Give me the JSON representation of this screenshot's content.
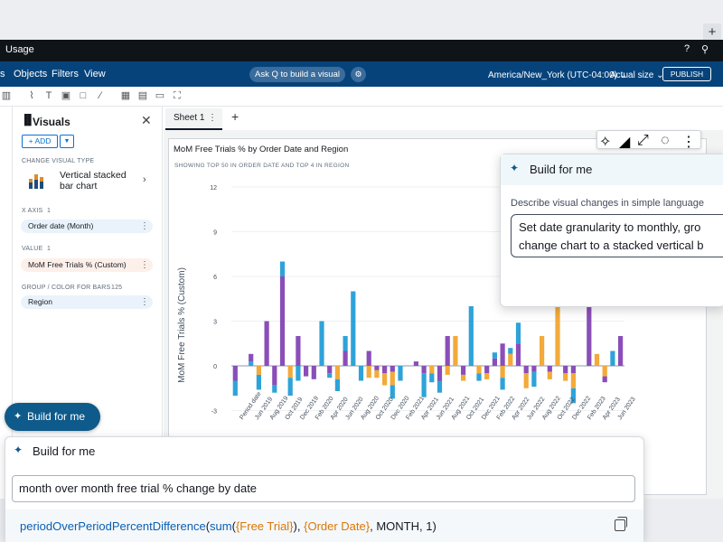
{
  "window": {
    "plus": "+",
    "title": "Usage"
  },
  "menubar": {
    "items": [
      "s",
      "Objects",
      "Filters",
      "View"
    ],
    "ask_q": "Ask Q to build a visual",
    "timezone": "America/New_York (UTC-04:00) ⌄",
    "fit": "Actual size ⌄",
    "publish": "PUBLISH"
  },
  "sheet": {
    "tab": "Sheet 1",
    "plus": "+"
  },
  "visuals_panel": {
    "title": "Visuals",
    "close": "✕",
    "add": "+ ADD",
    "add_drop": "▼",
    "change_type_label": "CHANGE VISUAL TYPE",
    "visual_type": "Vertical stacked bar chart",
    "x_axis_label": "X AXIS",
    "x_axis_count": "1",
    "x_axis_field": "Order date (Month)",
    "value_label": "VALUE",
    "value_count": "1",
    "value_field": "MoM Free Trials % (Custom)",
    "group_label": "GROUP / COLOR FOR BARS",
    "group_count": "125",
    "group_field": "Region"
  },
  "build_for_me_button": "Build for me",
  "visual": {
    "title": "MoM Free Trials % by Order Date and Region",
    "subtitle": "SHOWING TOP 50 IN ORDER DATE AND TOP 4 IN REGION"
  },
  "build_for_me_popover": {
    "title": "Build for me",
    "label": "Describe visual changes in simple language",
    "text_line1": "Set date granularity to monthly, gro",
    "text_line2": "change chart to a stacked vertical b"
  },
  "build_for_me_panel": {
    "title": "Build for me",
    "query": "month over month free trial % change by date",
    "formula_fn": "periodOverPeriodPercentDifference",
    "formula_sum": "sum",
    "formula_field1": "{Free Trial}",
    "formula_field2": "{Order Date}",
    "formula_rest": ", MONTH, 1)"
  },
  "colors": {
    "purple": "#8a4eb8",
    "blue": "#2ea3d9",
    "orange": "#f2aa3a",
    "nav": "#06437b",
    "accent": "#0e5a8a"
  },
  "chart_data": {
    "type": "bar",
    "stacked": true,
    "ylabel": "MoM Free Trials % (Custom)",
    "ylim": [
      -4.5,
      12
    ],
    "yticks": [
      12,
      9,
      6,
      3,
      0,
      -3
    ],
    "xtick_labels": [
      "Period date",
      "Jun 2019",
      "Aug 2019",
      "Oct 2019",
      "Dec 2019",
      "Feb 2020",
      "Apr 2020",
      "Jun 2020",
      "Aug 2020",
      "Oct 2020",
      "Dec 2020",
      "Feb 2021",
      "Apr 2021",
      "Jun 2021",
      "Aug 2021",
      "Oct 2021",
      "Dec 2021",
      "Feb 2022",
      "Apr 2022",
      "Jun 2022",
      "Aug 2022",
      "Oct 2022",
      "Dec 2022",
      "Feb 2023",
      "Apr 2023",
      "Jun 2023"
    ],
    "bars": [
      {
        "segs": [
          [
            "purple",
            -1
          ],
          [
            "blue",
            -1
          ]
        ]
      },
      {
        "segs": []
      },
      {
        "segs": [
          [
            "blue",
            0.3
          ],
          [
            "purple",
            0.5
          ]
        ]
      },
      {
        "segs": [
          [
            "orange",
            -0.6
          ],
          [
            "blue",
            -1
          ]
        ]
      },
      {
        "segs": [
          [
            "purple",
            3
          ]
        ]
      },
      {
        "segs": [
          [
            "purple",
            -1.3
          ],
          [
            "blue",
            -0.5
          ]
        ]
      },
      {
        "segs": [
          [
            "purple",
            6
          ],
          [
            "blue",
            1
          ]
        ]
      },
      {
        "segs": [
          [
            "orange",
            -0.8
          ],
          [
            "blue",
            -1.2
          ]
        ]
      },
      {
        "segs": [
          [
            "purple",
            2
          ],
          [
            "blue",
            -1
          ]
        ]
      },
      {
        "segs": [
          [
            "purple",
            -0.7
          ]
        ]
      },
      {
        "segs": [
          [
            "purple",
            -0.9
          ]
        ]
      },
      {
        "segs": [
          [
            "blue",
            3
          ]
        ]
      },
      {
        "segs": [
          [
            "purple",
            -0.5
          ],
          [
            "blue",
            -0.3
          ]
        ]
      },
      {
        "segs": [
          [
            "orange",
            -0.9
          ],
          [
            "blue",
            -0.8
          ]
        ]
      },
      {
        "segs": [
          [
            "purple",
            1
          ],
          [
            "blue",
            1
          ]
        ]
      },
      {
        "segs": [
          [
            "blue",
            5
          ]
        ]
      },
      {
        "segs": [
          [
            "blue",
            -1
          ]
        ]
      },
      {
        "segs": [
          [
            "purple",
            1
          ],
          [
            "orange",
            -0.8
          ]
        ]
      },
      {
        "segs": [
          [
            "purple",
            -0.3
          ],
          [
            "orange",
            -0.5
          ]
        ]
      },
      {
        "segs": [
          [
            "purple",
            -0.5
          ],
          [
            "orange",
            -0.8
          ]
        ]
      },
      {
        "segs": [
          [
            "purple",
            -0.4
          ],
          [
            "orange",
            -0.9
          ],
          [
            "blue",
            -0.9
          ]
        ]
      },
      {
        "segs": [
          [
            "blue",
            -1
          ]
        ]
      },
      {
        "segs": []
      },
      {
        "segs": [
          [
            "purple",
            0.3
          ]
        ]
      },
      {
        "segs": [
          [
            "purple",
            -0.5
          ],
          [
            "blue",
            -1.6
          ]
        ]
      },
      {
        "segs": [
          [
            "orange",
            -0.5
          ],
          [
            "blue",
            -0.6
          ]
        ]
      },
      {
        "segs": [
          [
            "purple",
            -1
          ],
          [
            "blue",
            -0.8
          ]
        ]
      },
      {
        "segs": [
          [
            "purple",
            2
          ],
          [
            "orange",
            -0.6
          ]
        ]
      },
      {
        "segs": [
          [
            "orange",
            2
          ]
        ]
      },
      {
        "segs": [
          [
            "purple",
            -0.6
          ],
          [
            "orange",
            -0.4
          ]
        ]
      },
      {
        "segs": [
          [
            "blue",
            4
          ]
        ]
      },
      {
        "segs": [
          [
            "orange",
            -0.5
          ],
          [
            "blue",
            -0.5
          ]
        ]
      },
      {
        "segs": [
          [
            "purple",
            -0.5
          ],
          [
            "orange",
            -0.4
          ]
        ]
      },
      {
        "segs": [
          [
            "purple",
            0.5
          ],
          [
            "blue",
            0.4
          ]
        ]
      },
      {
        "segs": [
          [
            "purple",
            1.5
          ],
          [
            "orange",
            -0.8
          ],
          [
            "blue",
            -0.8
          ]
        ]
      },
      {
        "segs": [
          [
            "orange",
            0.8
          ],
          [
            "blue",
            0.4
          ]
        ]
      },
      {
        "segs": [
          [
            "purple",
            1.5
          ],
          [
            "blue",
            1.4
          ]
        ]
      },
      {
        "segs": [
          [
            "purple",
            -0.5
          ],
          [
            "orange",
            -1
          ]
        ]
      },
      {
        "segs": [
          [
            "purple",
            -0.4
          ],
          [
            "blue",
            -1
          ]
        ]
      },
      {
        "segs": [
          [
            "orange",
            2
          ]
        ]
      },
      {
        "segs": [
          [
            "purple",
            -0.4
          ],
          [
            "orange",
            -0.5
          ]
        ]
      },
      {
        "segs": [
          [
            "orange",
            4
          ]
        ]
      },
      {
        "segs": [
          [
            "purple",
            -0.5
          ],
          [
            "orange",
            -0.5
          ]
        ]
      },
      {
        "segs": [
          [
            "purple",
            -0.5
          ],
          [
            "orange",
            -1
          ],
          [
            "blue",
            -1
          ]
        ]
      },
      {
        "segs": []
      },
      {
        "segs": [
          [
            "purple",
            4
          ]
        ]
      },
      {
        "segs": [
          [
            "orange",
            0.8
          ]
        ]
      },
      {
        "segs": [
          [
            "orange",
            -0.7
          ],
          [
            "purple",
            -0.4
          ]
        ]
      },
      {
        "segs": [
          [
            "blue",
            1
          ]
        ]
      },
      {
        "segs": [
          [
            "purple",
            2
          ]
        ]
      }
    ]
  }
}
